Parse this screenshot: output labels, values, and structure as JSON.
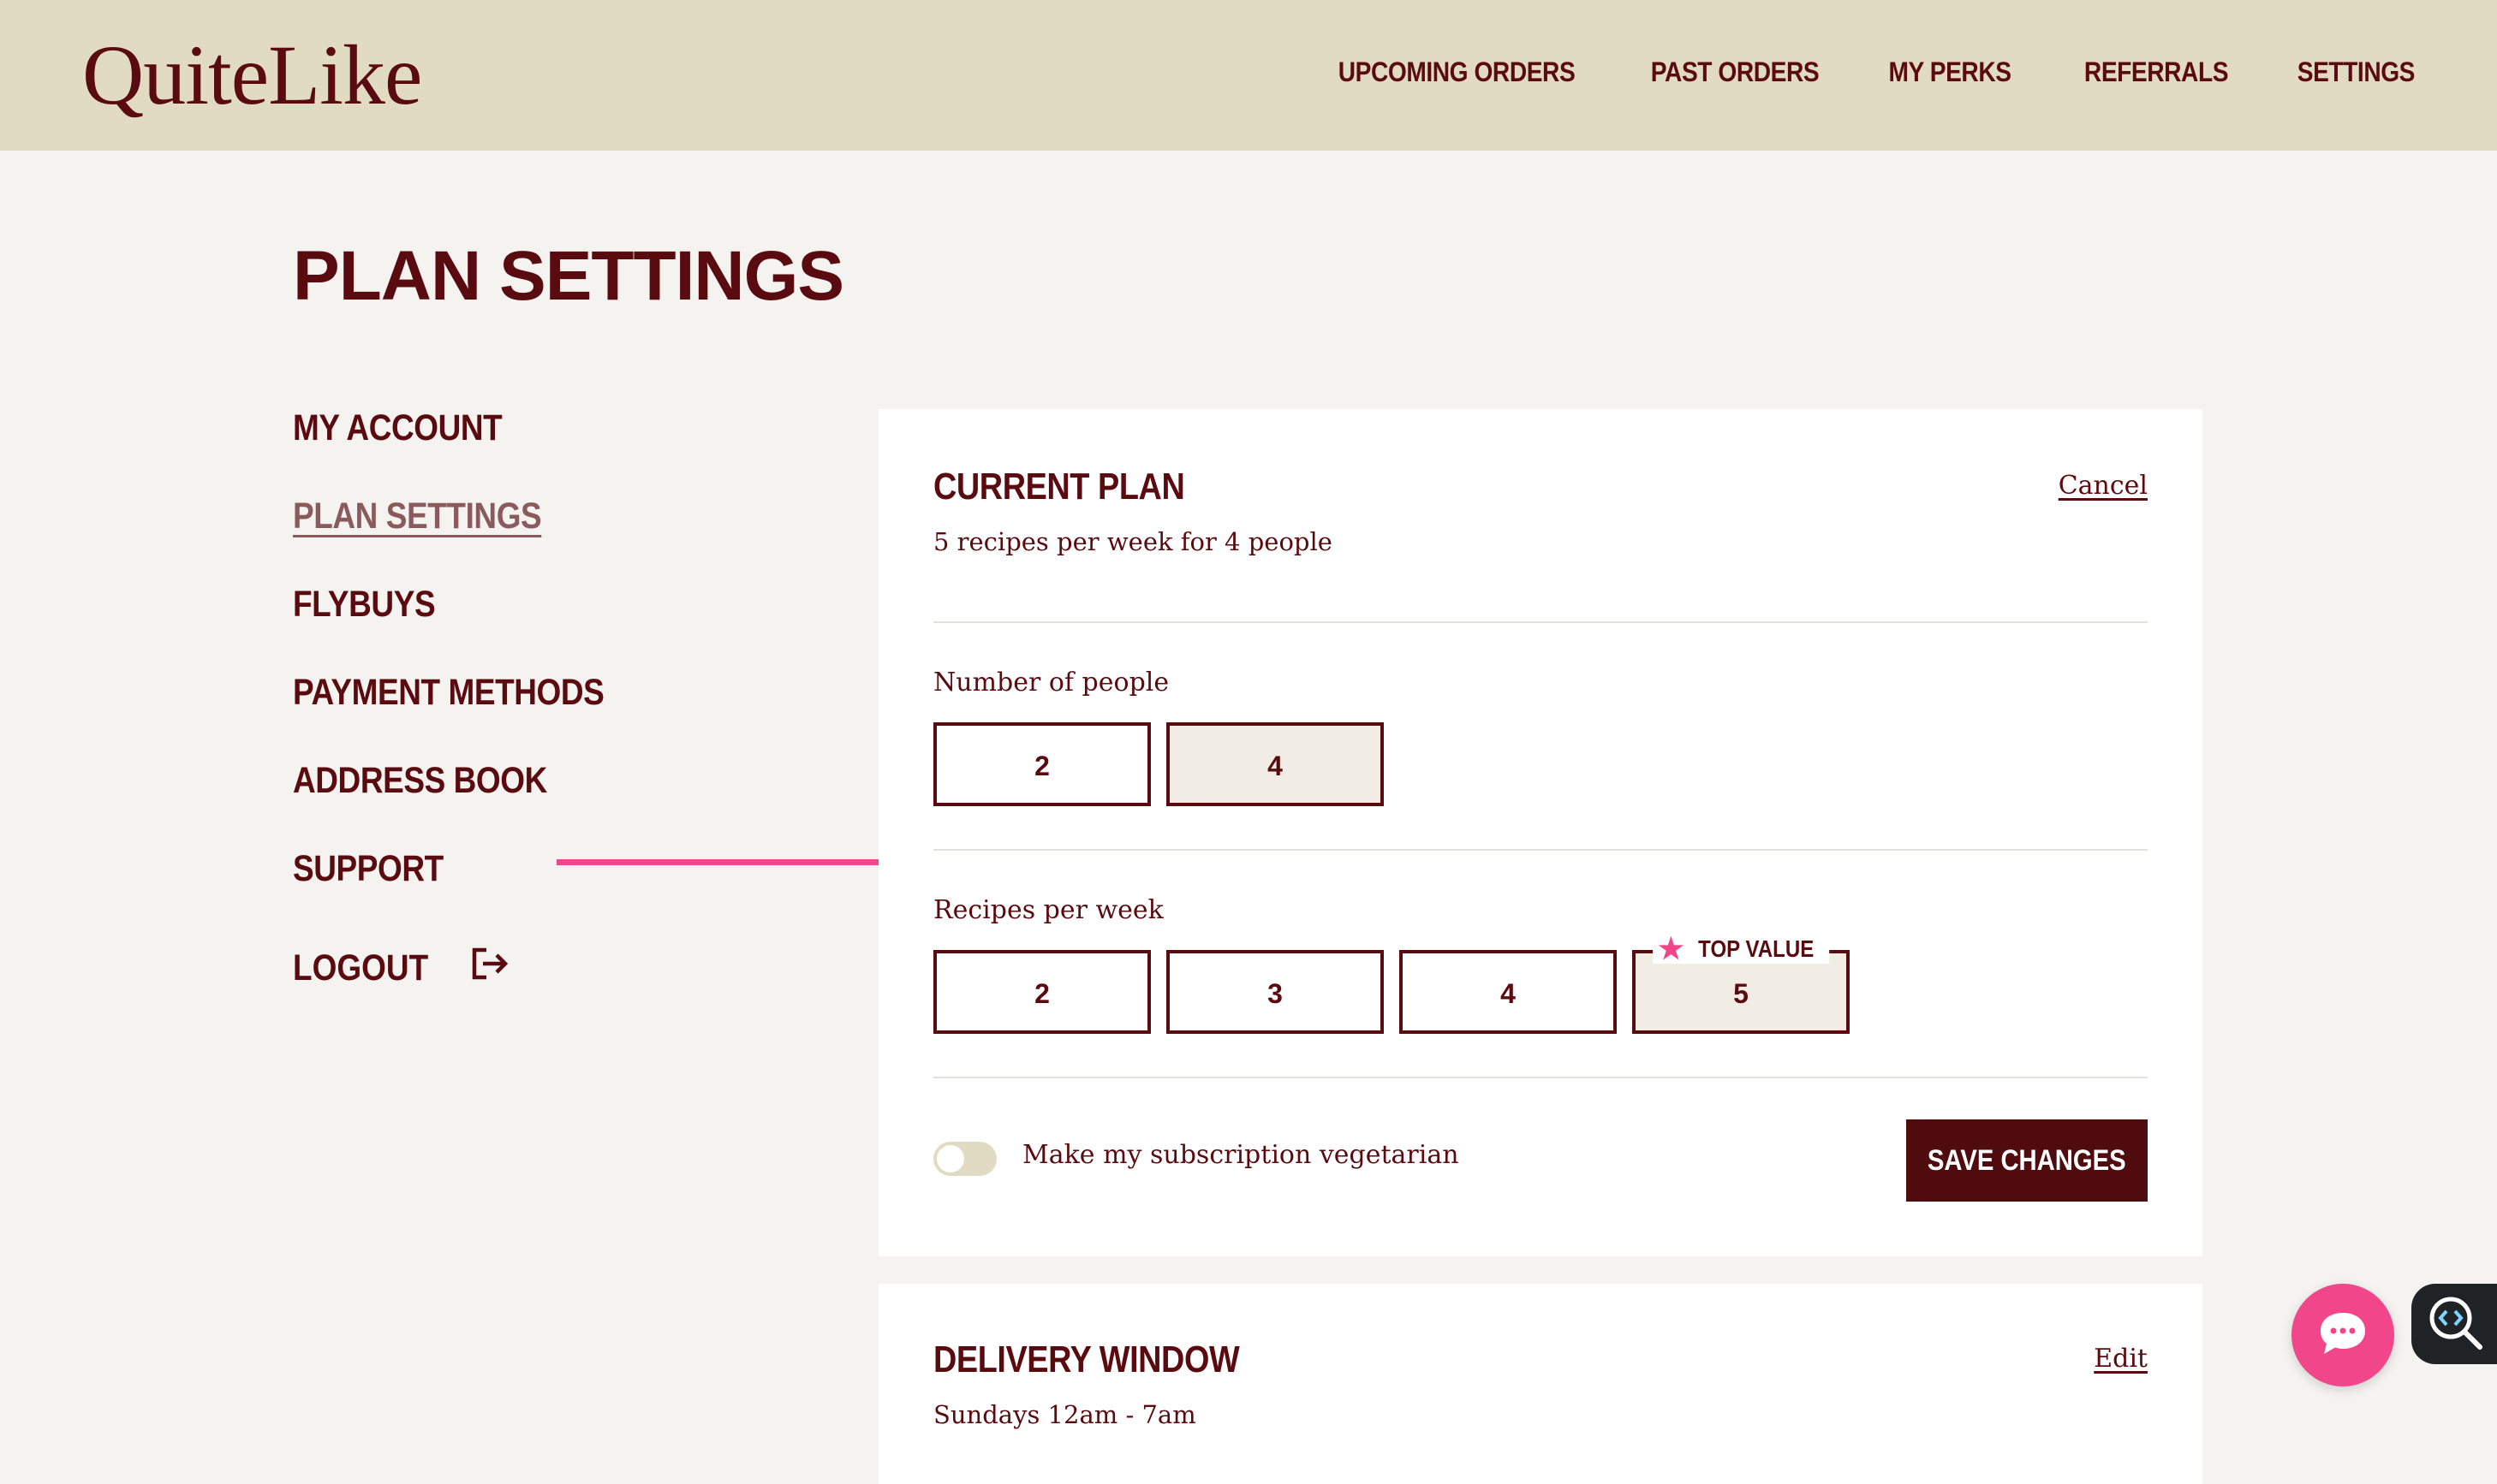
{
  "header": {
    "logo": "QuiteLike",
    "nav": [
      {
        "label": "UPCOMING ORDERS"
      },
      {
        "label": "PAST ORDERS"
      },
      {
        "label": "MY PERKS"
      },
      {
        "label": "REFERRALS"
      },
      {
        "label": "SETTINGS"
      }
    ]
  },
  "page": {
    "title": "PLAN SETTINGS"
  },
  "sidebar": {
    "items": [
      {
        "label": "MY ACCOUNT"
      },
      {
        "label": "PLAN SETTINGS",
        "active": true
      },
      {
        "label": "FLYBUYS"
      },
      {
        "label": "PAYMENT METHODS"
      },
      {
        "label": "ADDRESS BOOK"
      },
      {
        "label": "SUPPORT"
      }
    ],
    "logout": "LOGOUT"
  },
  "current_plan": {
    "title": "CURRENT PLAN",
    "summary": "5 recipes per week for 4 people",
    "cancel_label": "Cancel",
    "people": {
      "label": "Number of people",
      "options": [
        "2",
        "4"
      ],
      "selected": "4"
    },
    "recipes": {
      "label": "Recipes per week",
      "options": [
        "2",
        "3",
        "4",
        "5"
      ],
      "selected": "5",
      "badge": "TOP VALUE"
    },
    "vegetarian": {
      "label": "Make my subscription vegetarian",
      "enabled": false
    },
    "save_label": "SAVE CHANGES"
  },
  "delivery": {
    "title": "DELIVERY WINDOW",
    "value": "Sundays 12am - 7am",
    "edit_label": "Edit"
  },
  "colors": {
    "brand": "#5a0b10",
    "header_bg": "#e2dbc4",
    "page_bg": "#f4f3ef",
    "accent_pink": "#f2468a",
    "selected_bg": "#f1ede5"
  },
  "icons": {
    "logout": "logout-icon",
    "chat": "chat-icon",
    "inspect": "inspect-icon",
    "star": "star-icon"
  }
}
